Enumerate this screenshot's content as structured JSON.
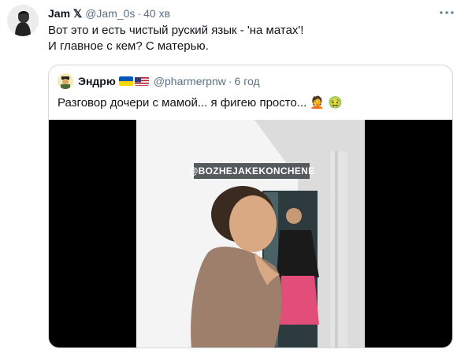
{
  "tweet": {
    "author_name": "Jam 𝕏",
    "author_handle": "@Jam_0s",
    "separator": "·",
    "time": "40 хв",
    "text_line1": "Вот это и есть чистый руский язык - 'на матах'!",
    "text_line2": "И главное с кем? С матерью."
  },
  "quoted": {
    "author_name": "Эндрю",
    "author_handle": "@pharmerpnw",
    "separator": "·",
    "time": "6 год",
    "text": "Разговор дочери с мамой... я фигею просто...",
    "emoji_1": "🤦",
    "emoji_2": "🤢",
    "video_watermark": "@BOZHEJAKEKONCHENE"
  },
  "icons": {
    "more": "more-icon",
    "ukraine_flag": "ukraine-flag-icon",
    "us_flag": "us-flag-icon"
  },
  "colors": {
    "secondary_text": "#5b7083",
    "border": "#cfd9de",
    "ukraine_blue": "#0057b7",
    "ukraine_yellow": "#ffd700"
  }
}
